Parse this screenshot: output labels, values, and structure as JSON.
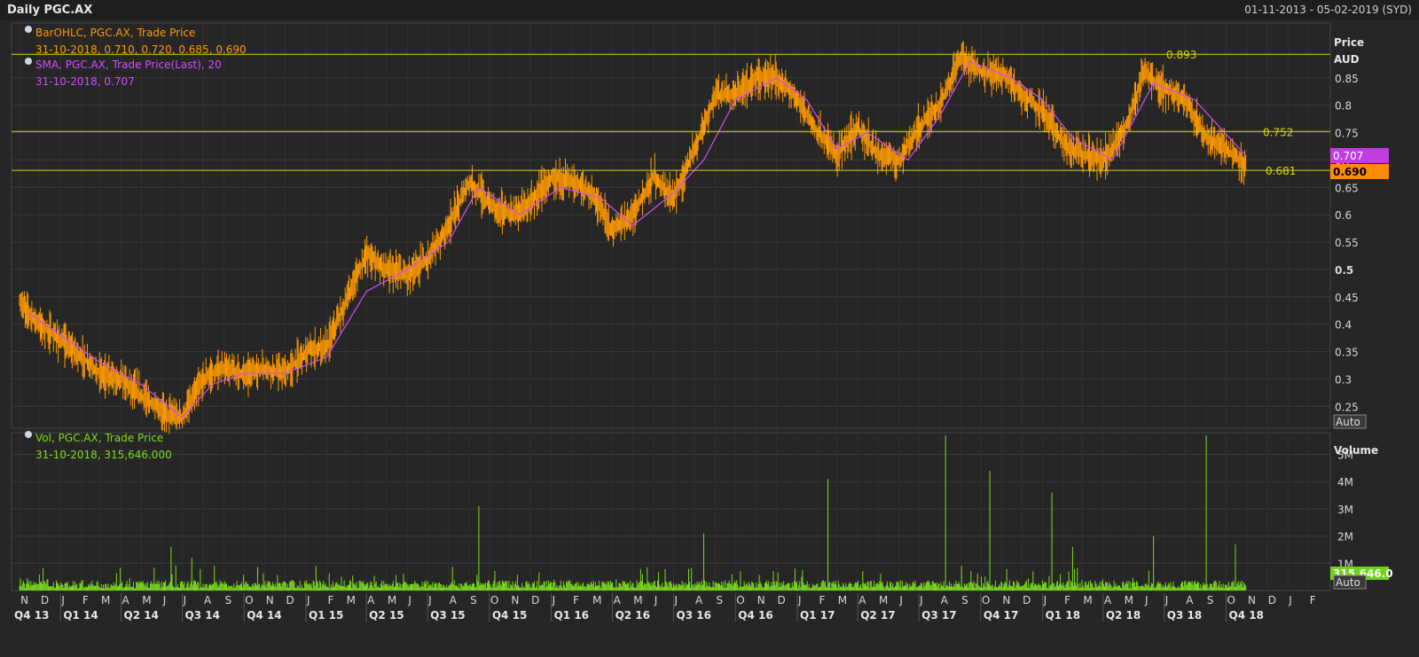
{
  "header": {
    "title": "Daily PGC.AX",
    "range": "01-11-2013 - 05-02-2019 (SYD)"
  },
  "colors": {
    "bar": "#ff9a00",
    "sma": "#d24bff",
    "volume": "#7ddc1f",
    "level_line": "#d8d800",
    "grid": "#3a3a3a",
    "text": "#c8c8c8"
  },
  "chart_data": [
    {
      "type": "line",
      "title": "Daily PGC.AX",
      "series": [
        {
          "name": "BarOHLC, PGC.AX, Trade Price",
          "legend_values": "31-10-2018, 0.710, 0.720, 0.685, 0.690",
          "last_value": "0.690",
          "points": [
            [
              "2013-11-01",
              0.44
            ],
            [
              "2013-12-01",
              0.4
            ],
            [
              "2014-01-01",
              0.37
            ],
            [
              "2014-02-01",
              0.34
            ],
            [
              "2014-03-01",
              0.31
            ],
            [
              "2014-04-01",
              0.3
            ],
            [
              "2014-05-01",
              0.27
            ],
            [
              "2014-06-01",
              0.24
            ],
            [
              "2014-07-01",
              0.23
            ],
            [
              "2014-08-01",
              0.3
            ],
            [
              "2014-09-01",
              0.32
            ],
            [
              "2014-10-01",
              0.31
            ],
            [
              "2014-11-01",
              0.32
            ],
            [
              "2014-12-01",
              0.31
            ],
            [
              "2015-01-01",
              0.35
            ],
            [
              "2015-02-01",
              0.36
            ],
            [
              "2015-03-01",
              0.44
            ],
            [
              "2015-04-01",
              0.53
            ],
            [
              "2015-05-01",
              0.5
            ],
            [
              "2015-06-01",
              0.49
            ],
            [
              "2015-07-01",
              0.52
            ],
            [
              "2015-08-01",
              0.58
            ],
            [
              "2015-09-01",
              0.66
            ],
            [
              "2015-10-01",
              0.62
            ],
            [
              "2015-11-01",
              0.6
            ],
            [
              "2015-12-01",
              0.62
            ],
            [
              "2016-01-01",
              0.67
            ],
            [
              "2016-02-01",
              0.66
            ],
            [
              "2016-03-01",
              0.64
            ],
            [
              "2016-04-01",
              0.57
            ],
            [
              "2016-05-01",
              0.6
            ],
            [
              "2016-06-01",
              0.67
            ],
            [
              "2016-07-01",
              0.63
            ],
            [
              "2016-08-01",
              0.72
            ],
            [
              "2016-09-01",
              0.82
            ],
            [
              "2016-10-01",
              0.82
            ],
            [
              "2016-11-01",
              0.85
            ],
            [
              "2016-12-01",
              0.85
            ],
            [
              "2017-01-01",
              0.81
            ],
            [
              "2017-02-01",
              0.75
            ],
            [
              "2017-03-01",
              0.71
            ],
            [
              "2017-04-01",
              0.76
            ],
            [
              "2017-05-01",
              0.71
            ],
            [
              "2017-06-01",
              0.7
            ],
            [
              "2017-07-01",
              0.76
            ],
            [
              "2017-08-01",
              0.8
            ],
            [
              "2017-09-01",
              0.89
            ],
            [
              "2017-10-01",
              0.86
            ],
            [
              "2017-11-01",
              0.86
            ],
            [
              "2017-12-01",
              0.82
            ],
            [
              "2018-01-01",
              0.79
            ],
            [
              "2018-02-01",
              0.73
            ],
            [
              "2018-03-01",
              0.71
            ],
            [
              "2018-04-01",
              0.7
            ],
            [
              "2018-05-01",
              0.75
            ],
            [
              "2018-06-01",
              0.86
            ],
            [
              "2018-07-01",
              0.83
            ],
            [
              "2018-08-01",
              0.81
            ],
            [
              "2018-09-01",
              0.74
            ],
            [
              "2018-10-01",
              0.72
            ],
            [
              "2018-10-31",
              0.69
            ]
          ]
        },
        {
          "name": "SMA, PGC.AX, Trade Price(Last), 20",
          "legend_values": "31-10-2018, 0.707",
          "last_value": "0.707",
          "points": [
            [
              "2013-11-15",
              0.42
            ],
            [
              "2014-01-01",
              0.38
            ],
            [
              "2014-03-01",
              0.33
            ],
            [
              "2014-05-01",
              0.29
            ],
            [
              "2014-07-01",
              0.23
            ],
            [
              "2014-08-15",
              0.29
            ],
            [
              "2014-10-01",
              0.31
            ],
            [
              "2014-12-01",
              0.31
            ],
            [
              "2015-02-01",
              0.34
            ],
            [
              "2015-04-01",
              0.46
            ],
            [
              "2015-06-01",
              0.5
            ],
            [
              "2015-08-01",
              0.55
            ],
            [
              "2015-09-15",
              0.65
            ],
            [
              "2015-11-15",
              0.6
            ],
            [
              "2016-01-15",
              0.65
            ],
            [
              "2016-03-15",
              0.63
            ],
            [
              "2016-05-01",
              0.58
            ],
            [
              "2016-07-01",
              0.64
            ],
            [
              "2016-08-15",
              0.7
            ],
            [
              "2016-10-01",
              0.81
            ],
            [
              "2016-12-01",
              0.85
            ],
            [
              "2017-01-15",
              0.81
            ],
            [
              "2017-03-01",
              0.72
            ],
            [
              "2017-04-15",
              0.75
            ],
            [
              "2017-06-15",
              0.7
            ],
            [
              "2017-08-01",
              0.78
            ],
            [
              "2017-09-15",
              0.88
            ],
            [
              "2017-11-15",
              0.85
            ],
            [
              "2018-01-01",
              0.81
            ],
            [
              "2018-02-15",
              0.74
            ],
            [
              "2018-04-15",
              0.7
            ],
            [
              "2018-06-15",
              0.84
            ],
            [
              "2018-08-15",
              0.81
            ],
            [
              "2018-10-31",
              0.707
            ]
          ]
        }
      ],
      "levels": [
        "0.893",
        "0.752",
        "0.681"
      ],
      "ylabel": "Price",
      "yunit": "AUD",
      "y_ticks": [
        "0.85",
        "0.8",
        "0.75",
        "0.7",
        "0.65",
        "0.6",
        "0.55",
        "0.5",
        "0.45",
        "0.4",
        "0.35",
        "0.3",
        "0.25"
      ],
      "ylim": [
        0.21,
        0.95
      ],
      "auto_label": "Auto"
    },
    {
      "type": "bar",
      "title": "Vol, PGC.AX, Trade Price",
      "legend_values": "31-10-2018, 315,646.000",
      "ylabel": "Volume",
      "last_value": "315,646.0",
      "y_ticks": [
        "5M",
        "4M",
        "3M",
        "2M",
        "1M"
      ],
      "ylim": [
        0,
        5800000
      ],
      "auto_label": "Auto",
      "spikes": [
        [
          "2014-06-15",
          1600000
        ],
        [
          "2014-07-15",
          1200000
        ],
        [
          "2015-09-15",
          3100000
        ],
        [
          "2016-08-15",
          2100000
        ],
        [
          "2017-02-15",
          4100000
        ],
        [
          "2017-08-10",
          5700000
        ],
        [
          "2017-10-15",
          4400000
        ],
        [
          "2018-01-15",
          3600000
        ],
        [
          "2018-02-15",
          1600000
        ],
        [
          "2018-06-15",
          2000000
        ],
        [
          "2018-09-01",
          5700000
        ],
        [
          "2018-10-15",
          1700000
        ]
      ],
      "baseline": 250000
    }
  ],
  "x_axis": {
    "months": [
      "N",
      "D",
      "J",
      "F",
      "M",
      "A",
      "M",
      "J",
      "J",
      "A",
      "S",
      "O",
      "N",
      "D",
      "J",
      "F",
      "M",
      "A",
      "M",
      "J",
      "J",
      "A",
      "S",
      "O",
      "N",
      "D",
      "J",
      "F",
      "M",
      "A",
      "M",
      "J",
      "J",
      "A",
      "S",
      "O",
      "N",
      "D",
      "J",
      "F",
      "M",
      "A",
      "M",
      "J",
      "J",
      "A",
      "S",
      "O",
      "N",
      "D",
      "J",
      "F",
      "M",
      "A",
      "M",
      "J",
      "J",
      "A",
      "S",
      "O",
      "N",
      "D",
      "J",
      "F"
    ],
    "quarters": [
      "Q4 13",
      "Q1 14",
      "Q2 14",
      "Q3 14",
      "Q4 14",
      "Q1 15",
      "Q2 15",
      "Q3 15",
      "Q4 15",
      "Q1 16",
      "Q2 16",
      "Q3 16",
      "Q4 16",
      "Q1 17",
      "Q2 17",
      "Q3 17",
      "Q4 17",
      "Q1 18",
      "Q2 18",
      "Q3 18",
      "Q4 18"
    ]
  }
}
